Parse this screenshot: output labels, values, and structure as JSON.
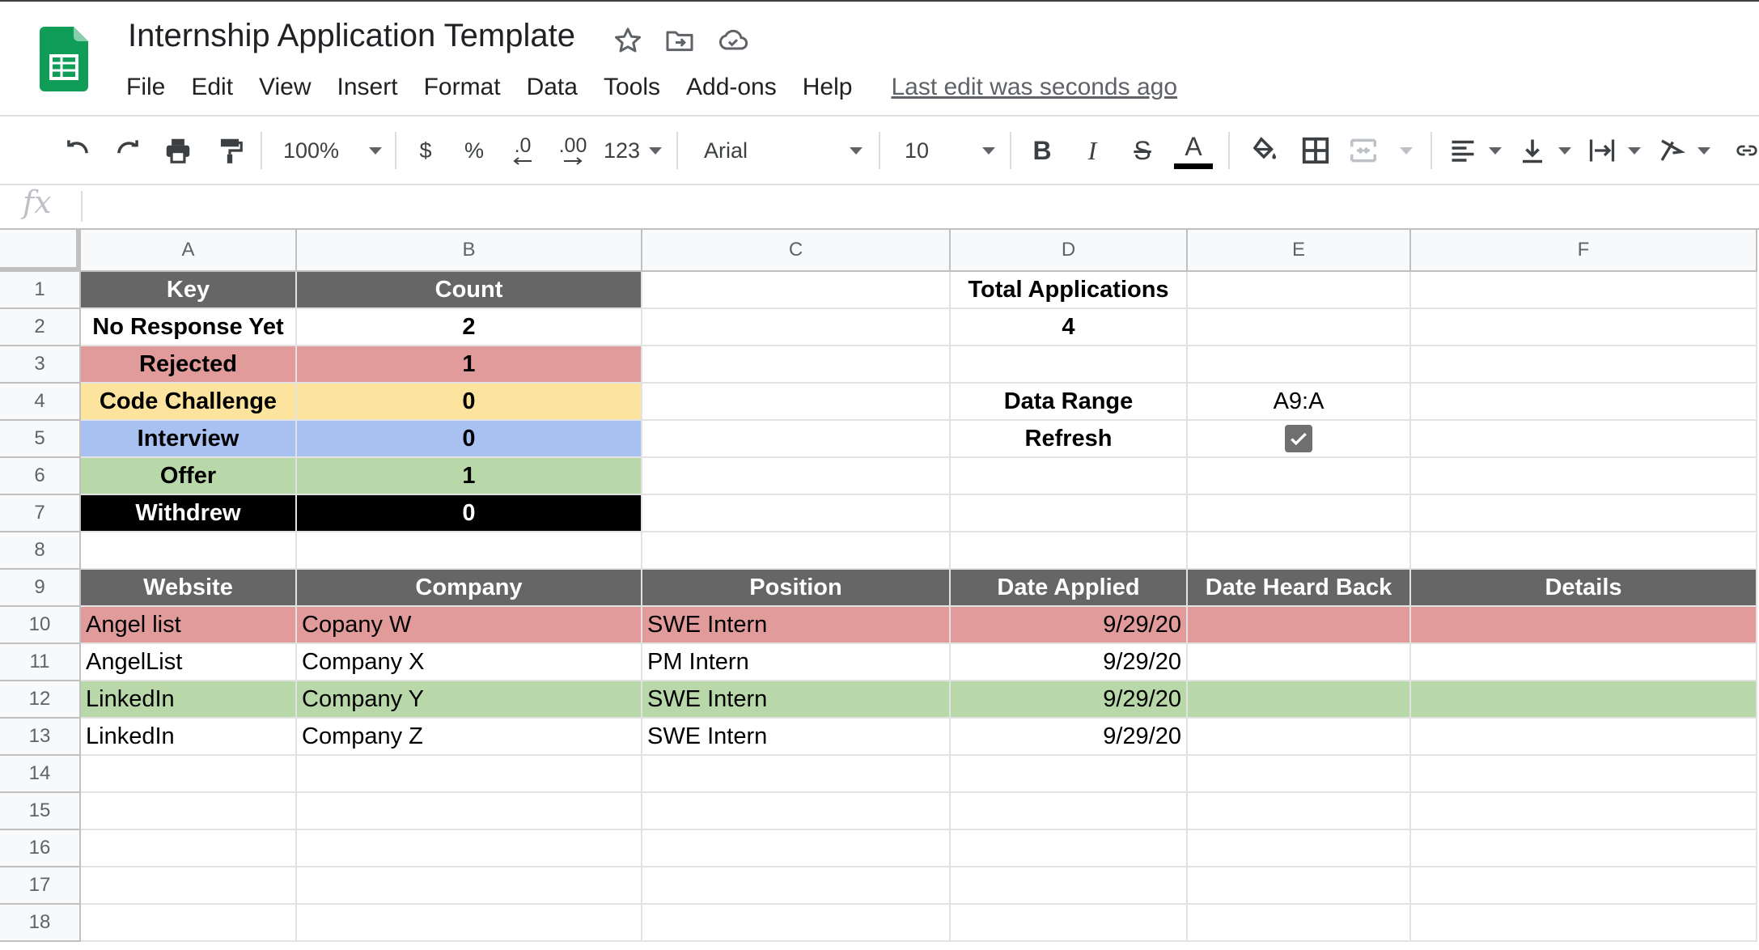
{
  "app": {
    "title": "Internship Application Template",
    "last_edit": "Last edit was seconds ago",
    "menu": [
      "File",
      "Edit",
      "View",
      "Insert",
      "Format",
      "Data",
      "Tools",
      "Add-ons",
      "Help"
    ]
  },
  "toolbar": {
    "zoom": "100%",
    "currency": "$",
    "percent": "%",
    "decrease_decimal": ".0",
    "increase_decimal": ".00",
    "more_formats": "123",
    "font": "Arial",
    "font_size": "10",
    "bold": "B",
    "italic": "I",
    "strikethrough": "S",
    "text_color": "A"
  },
  "formula_bar": {
    "fx": "fx",
    "value": ""
  },
  "columns": [
    "A",
    "B",
    "C",
    "D",
    "E",
    "F"
  ],
  "rows": [
    "1",
    "2",
    "3",
    "4",
    "5",
    "6",
    "7",
    "8",
    "9",
    "10",
    "11",
    "12",
    "13",
    "14",
    "15",
    "16",
    "17",
    "18"
  ],
  "summary": {
    "key_header": "Key",
    "count_header": "Count",
    "items": [
      {
        "key": "No Response Yet",
        "count": "2"
      },
      {
        "key": "Rejected",
        "count": "1"
      },
      {
        "key": "Code Challenge",
        "count": "0"
      },
      {
        "key": "Interview",
        "count": "0"
      },
      {
        "key": "Offer",
        "count": "1"
      },
      {
        "key": "Withdrew",
        "count": "0"
      }
    ],
    "total_label": "Total Applications",
    "total_value": "4",
    "data_range_label": "Data Range",
    "data_range_value": "A9:A",
    "refresh_label": "Refresh",
    "refresh_checked": true
  },
  "table": {
    "headers": [
      "Website",
      "Company",
      "Position",
      "Date Applied",
      "Date Heard Back",
      "Details"
    ],
    "rows": [
      {
        "website": "Angel list",
        "company": "Copany W",
        "position": "SWE Intern",
        "date_applied": "9/29/20",
        "date_heard_back": "",
        "details": "",
        "status_color": "#e19b9b"
      },
      {
        "website": "AngelList",
        "company": "Company X",
        "position": "PM Intern",
        "date_applied": "9/29/20",
        "date_heard_back": "",
        "details": "",
        "status_color": "#ffffff"
      },
      {
        "website": "LinkedIn",
        "company": "Company Y",
        "position": "SWE Intern",
        "date_applied": "9/29/20",
        "date_heard_back": "",
        "details": "",
        "status_color": "#b9d8a9"
      },
      {
        "website": "LinkedIn",
        "company": "Company Z",
        "position": "SWE Intern",
        "date_applied": "9/29/20",
        "date_heard_back": "",
        "details": "",
        "status_color": "#ffffff"
      }
    ]
  },
  "colors": {
    "header_gray": "#666666",
    "rejected": "#e19b9b",
    "code_challenge": "#fce39e",
    "interview": "#a8c1f1",
    "offer": "#b9d8a9",
    "withdrew": "#000000",
    "sheets_green": "#0f9d58"
  }
}
